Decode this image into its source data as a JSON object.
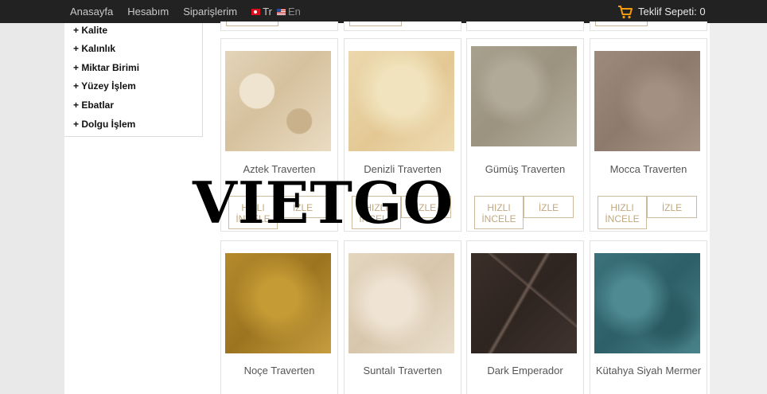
{
  "nav": {
    "links": [
      "Anasayfa",
      "Hesabım",
      "Siparişlerim"
    ],
    "lang_tr": "Tr",
    "lang_en": "En",
    "cart_label": "Teklif Sepeti: 0",
    "cart_icon": "shopping-cart-icon",
    "accent_color": "#f39c12"
  },
  "filters": [
    "+ Kalite",
    "+ Kalınlık",
    "+ Miktar Birimi",
    "+ Yüzey İşlem",
    "+ Ebatlar",
    "+ Dolgu İşlem"
  ],
  "buttons": {
    "quick_view": "HIZLI\nİNCELE",
    "view": "İZLE"
  },
  "products_row1": [
    "Aztek Traverten",
    "Denizli Traverten",
    "Gümüş Traverten",
    "Mocca Traverten"
  ],
  "products_row2": [
    "Noçe Traverten",
    "Suntalı Traverten",
    "Dark Emperador",
    "Kütahya Siyah Mermer"
  ],
  "watermark": "VIETGO"
}
